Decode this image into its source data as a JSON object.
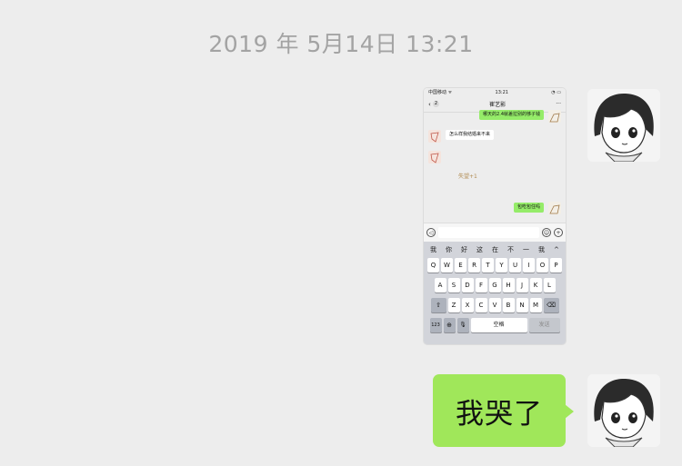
{
  "timestamp": "2019 年 5月14日 13:21",
  "screenshot": {
    "status": {
      "carrier": "中国移动 ᯤ",
      "time": "13:21",
      "right": "◔ ▭"
    },
    "header": {
      "back": "‹",
      "unread": "2",
      "title": "崔艺影",
      "more": "···"
    },
    "messages": [
      {
        "text": "哪天的2.4就差拉别的够子钱",
        "side": "right"
      },
      {
        "text": "怎么样我结婚来不来",
        "side": "left"
      },
      {
        "text": "失望+1",
        "side": "left"
      },
      {
        "text": "包吃包住吗",
        "side": "right"
      }
    ],
    "input": {
      "voice_icon": "voice-icon",
      "emoji_icon": "emoji-icon",
      "plus_icon": "plus-icon"
    },
    "keyboard": {
      "candidates": [
        "我",
        "你",
        "好",
        "这",
        "在",
        "不",
        "一",
        "我",
        "^"
      ],
      "row1": [
        "Q",
        "W",
        "E",
        "R",
        "T",
        "Y",
        "U",
        "I",
        "O",
        "P"
      ],
      "row2": [
        "A",
        "S",
        "D",
        "F",
        "G",
        "H",
        "J",
        "K",
        "L"
      ],
      "shift": "⇧",
      "row3": [
        "Z",
        "X",
        "C",
        "V",
        "B",
        "N",
        "M"
      ],
      "delete": "⌫",
      "num": "123",
      "globe": "⊕",
      "mic": "🎙",
      "space": "空格",
      "send": "发送"
    }
  },
  "message": {
    "text": "我哭了"
  }
}
